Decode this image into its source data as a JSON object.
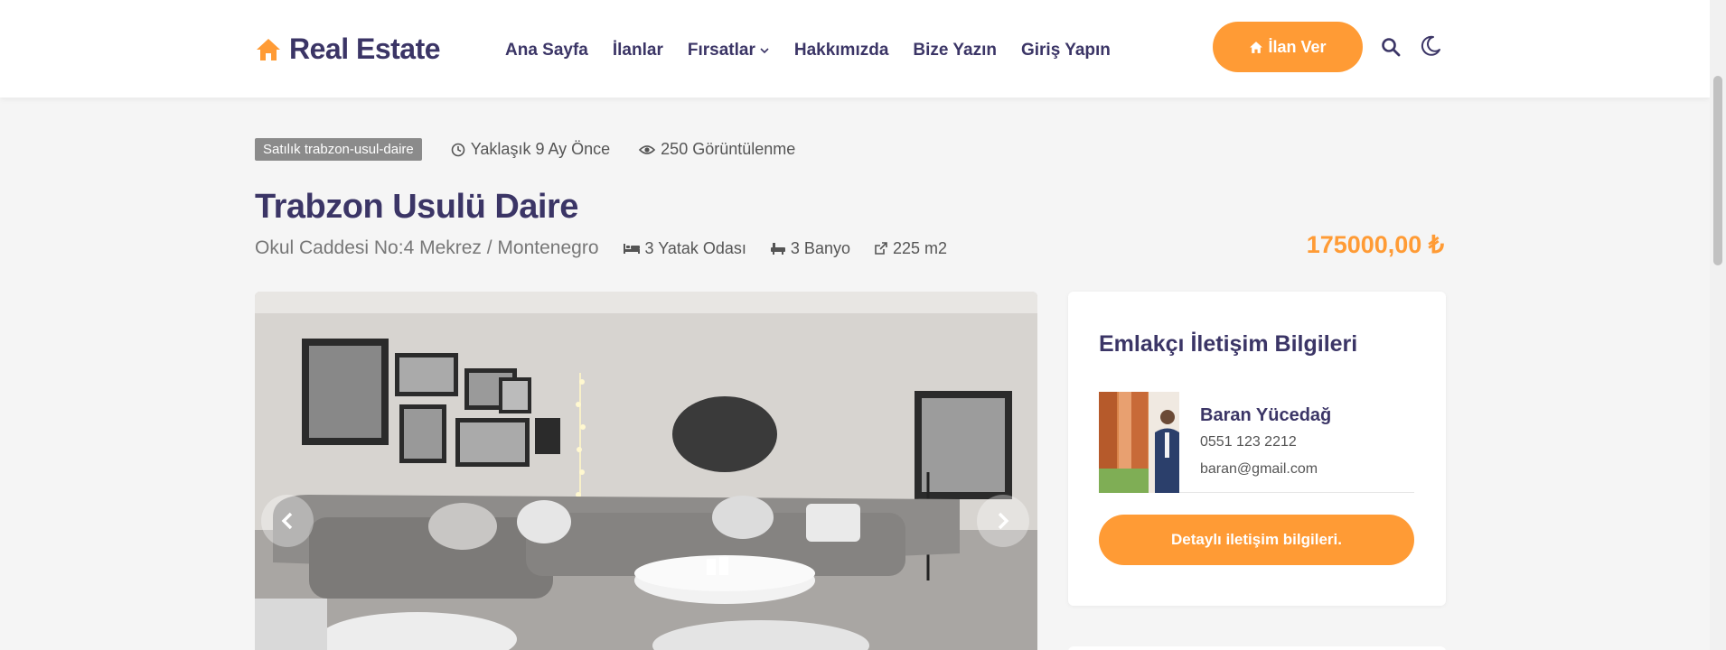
{
  "brand": {
    "name": "Real Estate",
    "icon": "home-icon",
    "color": "#ff9b35"
  },
  "nav": {
    "items": [
      {
        "label": "Ana Sayfa"
      },
      {
        "label": "İlanlar"
      },
      {
        "label": "Fırsatlar",
        "icon": "chevron-down-icon"
      },
      {
        "label": "Hakkımızda"
      },
      {
        "label": "Bize Yazın"
      },
      {
        "label": "Giriş Yapın"
      }
    ],
    "cta_label": "İlan Ver",
    "search_icon": "search-icon",
    "theme_icon": "moon-icon"
  },
  "listing": {
    "tag": "Satılık trabzon-usul-daire",
    "time": "Yaklaşık 9 Ay Önce",
    "views": "250 Görüntülenme",
    "title": "Trabzon Usulü Daire",
    "address": "Okul Caddesi No:4 Mekrez / Montenegro",
    "bedrooms": "3 Yatak Odası",
    "bathrooms": "3 Banyo",
    "area": "225 m2",
    "price": "175000,00 ₺"
  },
  "gallery": {
    "prev_icon": "chevron-left-icon",
    "next_icon": "chevron-right-icon"
  },
  "contact": {
    "title": "Emlakçı İletişim Bilgileri",
    "name": "Baran Yücedağ",
    "phone": "0551 123 2212",
    "email": "baran@gmail.com",
    "button_label": "Detaylı iletişim bilgileri."
  },
  "colors": {
    "accent": "#ff9b35",
    "text": "#3b3566",
    "background": "#f5f5f5"
  }
}
